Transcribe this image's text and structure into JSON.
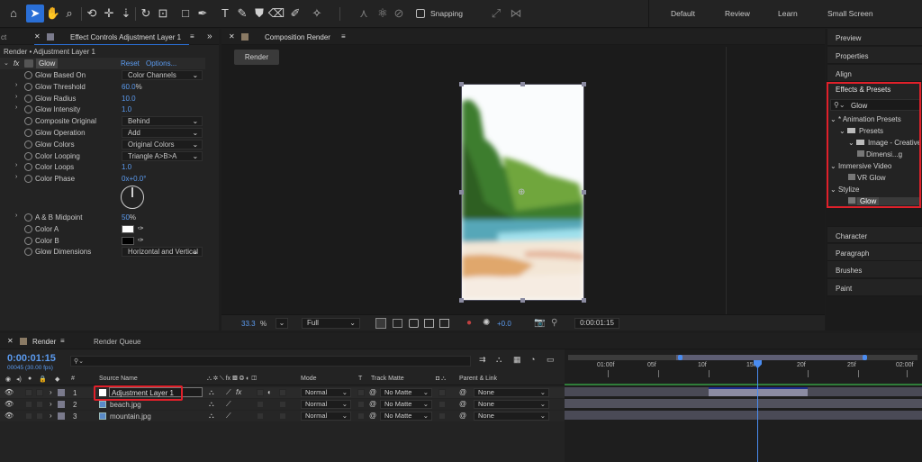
{
  "toolbar": {
    "tools": [
      "home-icon",
      "selection-arrow-icon",
      "hand-icon",
      "zoom-icon",
      "rotate-icon",
      "camera-orbit-icon",
      "pan-behind-icon",
      "rectangle-icon",
      "pen-icon",
      "type-icon",
      "brush-icon",
      "clone-stamp-icon",
      "eraser-icon",
      "roto-brush-icon",
      "puppet-pin-icon"
    ],
    "snapping_label": "Snapping",
    "workspaces": [
      "Default",
      "Review",
      "Learn",
      "Small Screen"
    ]
  },
  "effect_controls": {
    "tab_prefix": "ct",
    "tab_title": "Effect Controls Adjustment Layer 1",
    "breadcrumb": "Render • Adjustment Layer 1",
    "fx_label": "fx",
    "effect_name": "Glow",
    "reset_label": "Reset",
    "options_label": "Options...",
    "properties": [
      {
        "label": "Glow Based On",
        "kind": "dropdown",
        "value": "Color Channels",
        "twirl": false,
        "stopwatch": true
      },
      {
        "label": "Glow Threshold",
        "kind": "number",
        "value": "60.0",
        "unit": "%",
        "twirl": true,
        "stopwatch": true
      },
      {
        "label": "Glow Radius",
        "kind": "number",
        "value": "10.0",
        "unit": "",
        "twirl": true,
        "stopwatch": true
      },
      {
        "label": "Glow Intensity",
        "kind": "number",
        "value": "1.0",
        "unit": "",
        "twirl": true,
        "stopwatch": true
      },
      {
        "label": "Composite Original",
        "kind": "dropdown",
        "value": "Behind",
        "twirl": false,
        "stopwatch": true
      },
      {
        "label": "Glow Operation",
        "kind": "dropdown",
        "value": "Add",
        "twirl": false,
        "stopwatch": true
      },
      {
        "label": "Glow Colors",
        "kind": "dropdown",
        "value": "Original Colors",
        "twirl": false,
        "stopwatch": true
      },
      {
        "label": "Color Looping",
        "kind": "dropdown",
        "value": "Triangle A>B>A",
        "twirl": false,
        "stopwatch": true
      },
      {
        "label": "Color Loops",
        "kind": "number",
        "value": "1.0",
        "unit": "",
        "twirl": true,
        "stopwatch": true
      },
      {
        "label": "Color Phase",
        "kind": "number",
        "value": "0x+0.0°",
        "unit": "",
        "twirl": true,
        "stopwatch": true
      }
    ],
    "after_dial": [
      {
        "label": "A & B Midpoint",
        "kind": "number",
        "value": "50",
        "unit": "%",
        "twirl": true,
        "stopwatch": true
      },
      {
        "label": "Color A",
        "kind": "color",
        "value": "#ffffff",
        "twirl": false,
        "stopwatch": true
      },
      {
        "label": "Color B",
        "kind": "color",
        "value": "#000000",
        "twirl": false,
        "stopwatch": true
      },
      {
        "label": "Glow Dimensions",
        "kind": "dropdown",
        "value": "Horizontal and Vertical",
        "twirl": false,
        "stopwatch": true
      }
    ]
  },
  "composition": {
    "tab_title": "Composition Render",
    "render_button": "Render",
    "zoom": "33.3",
    "zoom_unit": "%",
    "resolution": "Full",
    "exposure": "+0.0",
    "timecode": "0:00:01:15"
  },
  "right_panel": {
    "top_items": [
      "Preview",
      "Properties",
      "Align"
    ],
    "effects_title": "Effects & Presets",
    "search_value": "Glow",
    "tree": [
      {
        "label": "* Animation Presets",
        "indent": 0,
        "type": "group"
      },
      {
        "label": "Presets",
        "indent": 1,
        "type": "folder"
      },
      {
        "label": "Image - Creative",
        "indent": 2,
        "type": "folder"
      },
      {
        "label": "Dimensi...g",
        "indent": 3,
        "type": "preset"
      },
      {
        "label": "Immersive Video",
        "indent": 0,
        "type": "group"
      },
      {
        "label": "VR Glow",
        "indent": 2,
        "type": "effect"
      },
      {
        "label": "Stylize",
        "indent": 0,
        "type": "group"
      },
      {
        "label": "Glow",
        "indent": 2,
        "type": "effect-selected"
      }
    ],
    "bottom_items": [
      "Character",
      "Paragraph",
      "Brushes",
      "Paint"
    ],
    "highlight_color": "#e0202a"
  },
  "timeline": {
    "tab_render": "Render",
    "tab_queue": "Render Queue",
    "timecode": "0:00:01:15",
    "frames": "00045 (30.00 fps)",
    "columns": {
      "num": "#",
      "source": "Source Name",
      "mode": "Mode",
      "t": "T",
      "track_matte": "Track Matte",
      "parent": "Parent & Link"
    },
    "layers": [
      {
        "num": "1",
        "name": "Adjustment Layer 1",
        "mode": "Normal",
        "matte": "No Matte",
        "parent": "None",
        "icon": "adjustment"
      },
      {
        "num": "2",
        "name": "beach.jpg",
        "mode": "Normal",
        "matte": "No Matte",
        "parent": "None",
        "icon": "image"
      },
      {
        "num": "3",
        "name": "mountain.jpg",
        "mode": "Normal",
        "matte": "No Matte",
        "parent": "None",
        "icon": "image"
      }
    ],
    "ruler": [
      "01:00f",
      "05f",
      "10f",
      "15f",
      "20f",
      "25f",
      "02:00f"
    ]
  }
}
